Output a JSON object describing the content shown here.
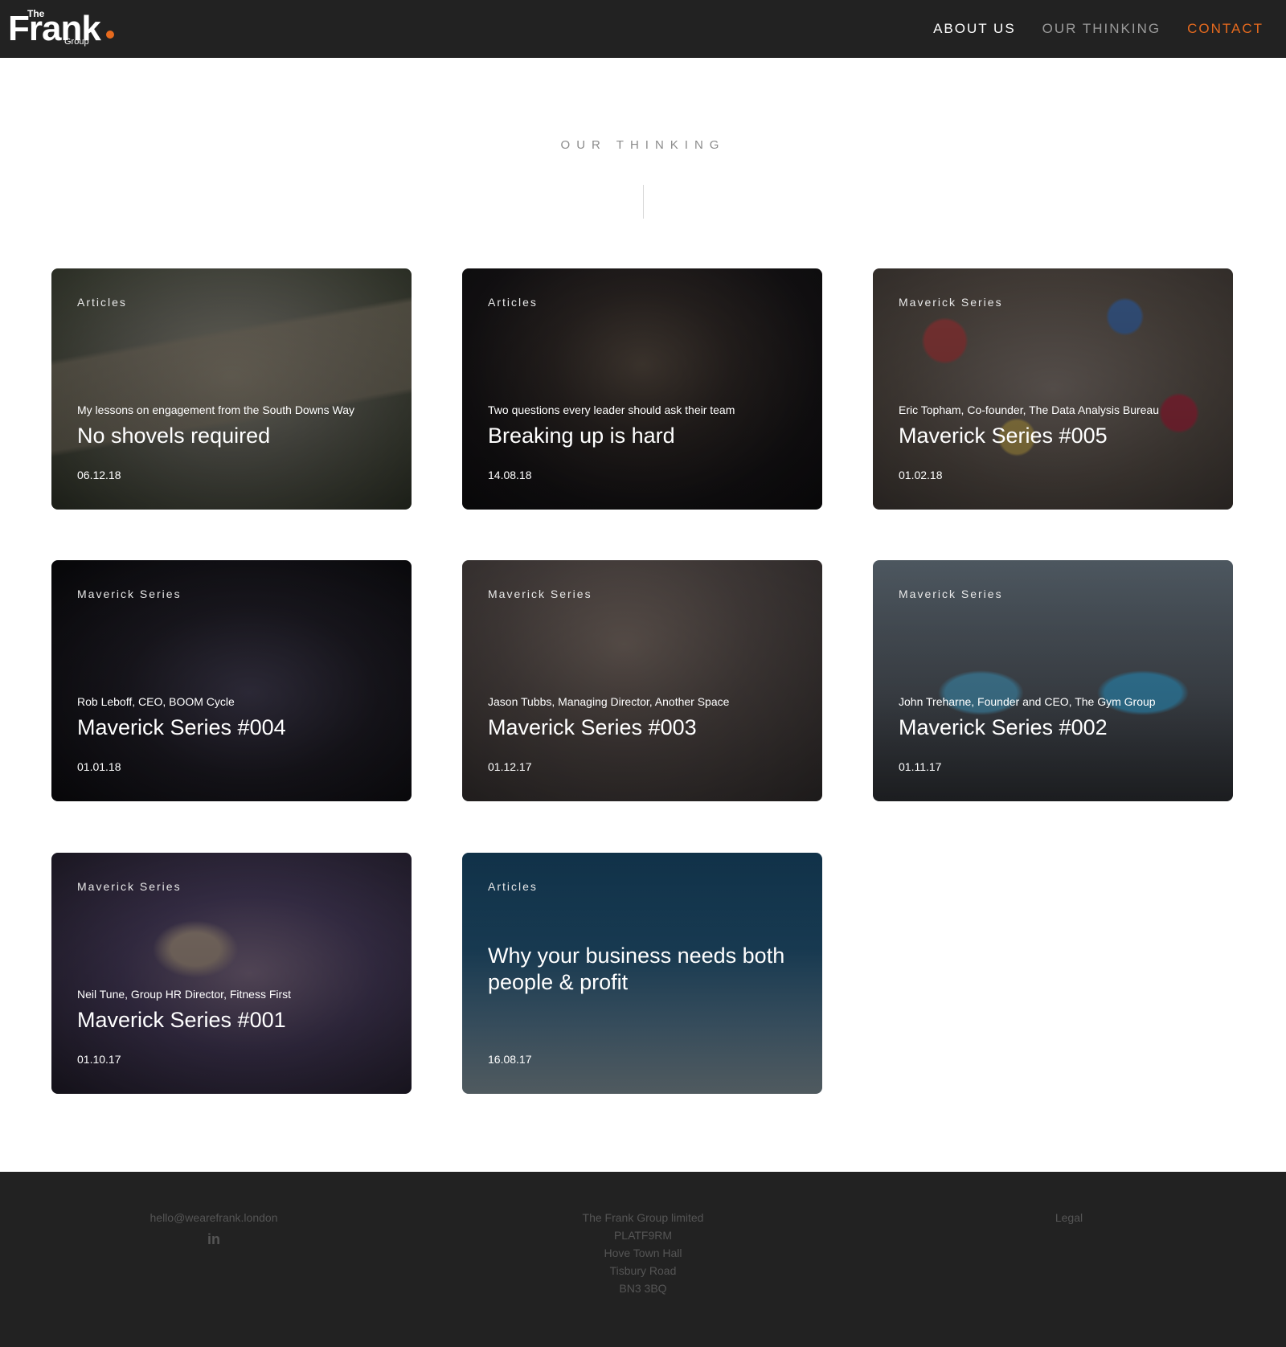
{
  "header": {
    "logo": {
      "the": "The",
      "name": "Frank",
      "group": "Group"
    },
    "nav": [
      {
        "label": "ABOUT US"
      },
      {
        "label": "OUR THINKING"
      },
      {
        "label": "CONTACT"
      }
    ]
  },
  "section": {
    "title": "OUR THINKING"
  },
  "cards": [
    {
      "category": "Articles",
      "subtitle": "My lessons on engagement from the South Downs Way",
      "title": "No shovels required",
      "date": "06.12.18"
    },
    {
      "category": "Articles",
      "subtitle": "Two questions every leader should ask their team",
      "title": "Breaking up is hard",
      "date": "14.08.18"
    },
    {
      "category": "Maverick Series",
      "subtitle": "Eric Topham, Co-founder, The Data Analysis Bureau",
      "title": "Maverick Series #005",
      "date": "01.02.18"
    },
    {
      "category": "Maverick Series",
      "subtitle": "Rob Leboff, CEO, BOOM Cycle",
      "title": "Maverick Series #004",
      "date": "01.01.18"
    },
    {
      "category": "Maverick Series",
      "subtitle": "Jason Tubbs, Managing Director, Another Space",
      "title": "Maverick Series #003",
      "date": "01.12.17"
    },
    {
      "category": "Maverick Series",
      "subtitle": "John Treharne, Founder and CEO, The Gym Group",
      "title": "Maverick Series #002",
      "date": "01.11.17"
    },
    {
      "category": "Maverick Series",
      "subtitle": "Neil Tune, Group HR Director, Fitness First",
      "title": "Maverick Series #001",
      "date": "01.10.17"
    },
    {
      "category": "Articles",
      "subtitle": "",
      "title": "Why your business needs both people & profit",
      "date": "16.08.17"
    }
  ],
  "footer": {
    "email": "hello@wearefrank.london",
    "linkedin_icon": "linkedin-icon",
    "address": [
      "The Frank Group limited",
      "PLATF9RM",
      "Hove Town Hall",
      "Tisbury Road",
      "BN3 3BQ"
    ],
    "legal": "Legal"
  },
  "colors": {
    "accent": "#e66a1e",
    "header_bg": "#222222",
    "footer_bg": "#222222"
  }
}
